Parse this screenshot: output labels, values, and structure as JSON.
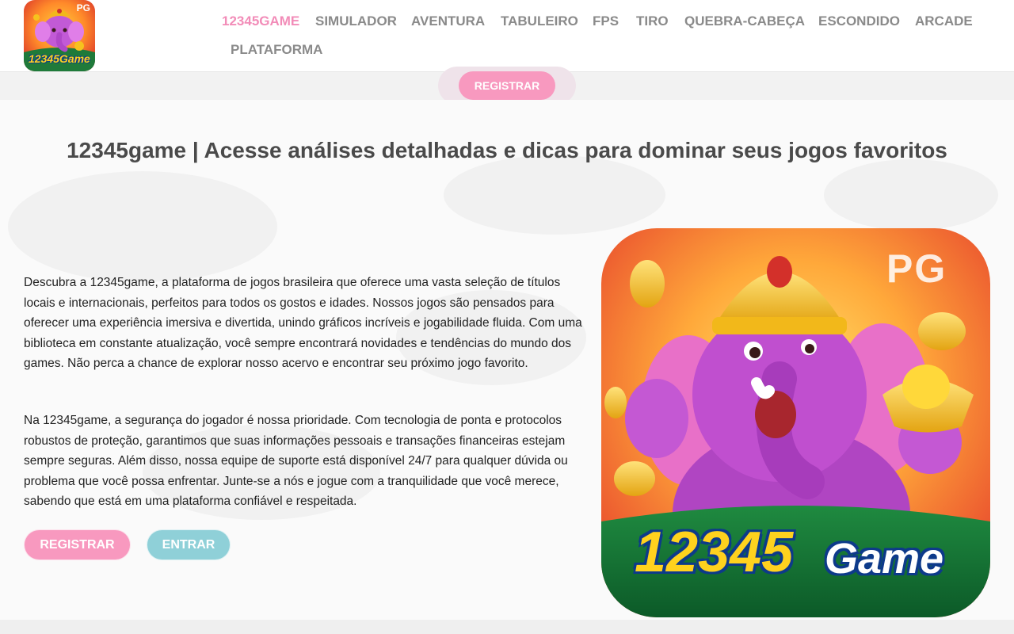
{
  "header": {
    "logo": {
      "icon": "ganesha-logo-icon",
      "badge_text": "PG",
      "brand_text": "12345Game"
    },
    "nav": [
      {
        "label": "12345GAME",
        "active": true
      },
      {
        "label": "SIMULADOR",
        "active": false
      },
      {
        "label": "AVENTURA",
        "active": false
      },
      {
        "label": "TABULEIRO",
        "active": false
      },
      {
        "label": "FPS",
        "active": false
      },
      {
        "label": "TIRO",
        "active": false
      },
      {
        "label": "QUEBRA-CABEÇA",
        "active": false
      },
      {
        "label": "ESCONDIDO",
        "active": false
      },
      {
        "label": "ARCADE",
        "active": false
      },
      {
        "label": "PLATAFORMA",
        "active": false
      }
    ]
  },
  "register_bar": {
    "button_label": "REGISTRAR"
  },
  "main": {
    "title": "12345game | Acesse análises detalhadas e dicas para dominar seus jogos favoritos",
    "paragraphs": [
      "Descubra a 12345game, a plataforma de jogos brasileira que oferece uma vasta seleção de títulos locais e internacionais, perfeitos para todos os gostos e idades. Nossos jogos são pensados para oferecer uma experiência imersiva e divertida, unindo gráficos incríveis e jogabilidade fluida. Com uma biblioteca em constante atualização, você sempre encontrará novidades e tendências do mundo dos games. Não perca a chance de explorar nosso acervo e encontrar seu próximo jogo favorito.",
      "Na 12345game, a segurança do jogador é nossa prioridade. Com tecnologia de ponta e protocolos robustos de proteção, garantimos que suas informações pessoais e transações financeiras estejam sempre seguras. Além disso, nossa equipe de suporte está disponível 24/7 para qualquer dúvida ou problema que você possa enfrentar. Junte-se a nós e jogue com a tranquilidade que você merece, sabendo que está em uma plataforma confiável e respeitada."
    ],
    "buttons": {
      "register": "REGISTRAR",
      "login": "ENTRAR"
    },
    "hero": {
      "icon": "ganesha-game-art-icon",
      "badge_text": "PG",
      "brand_number": "12345",
      "brand_word": "Game"
    }
  },
  "colors": {
    "accent_pink": "#f899bf",
    "nav_active": "#f28cb8",
    "nav_text": "#8a8a8a",
    "login_teal": "#8fd0d8",
    "title_gray": "#4a4a4a"
  }
}
